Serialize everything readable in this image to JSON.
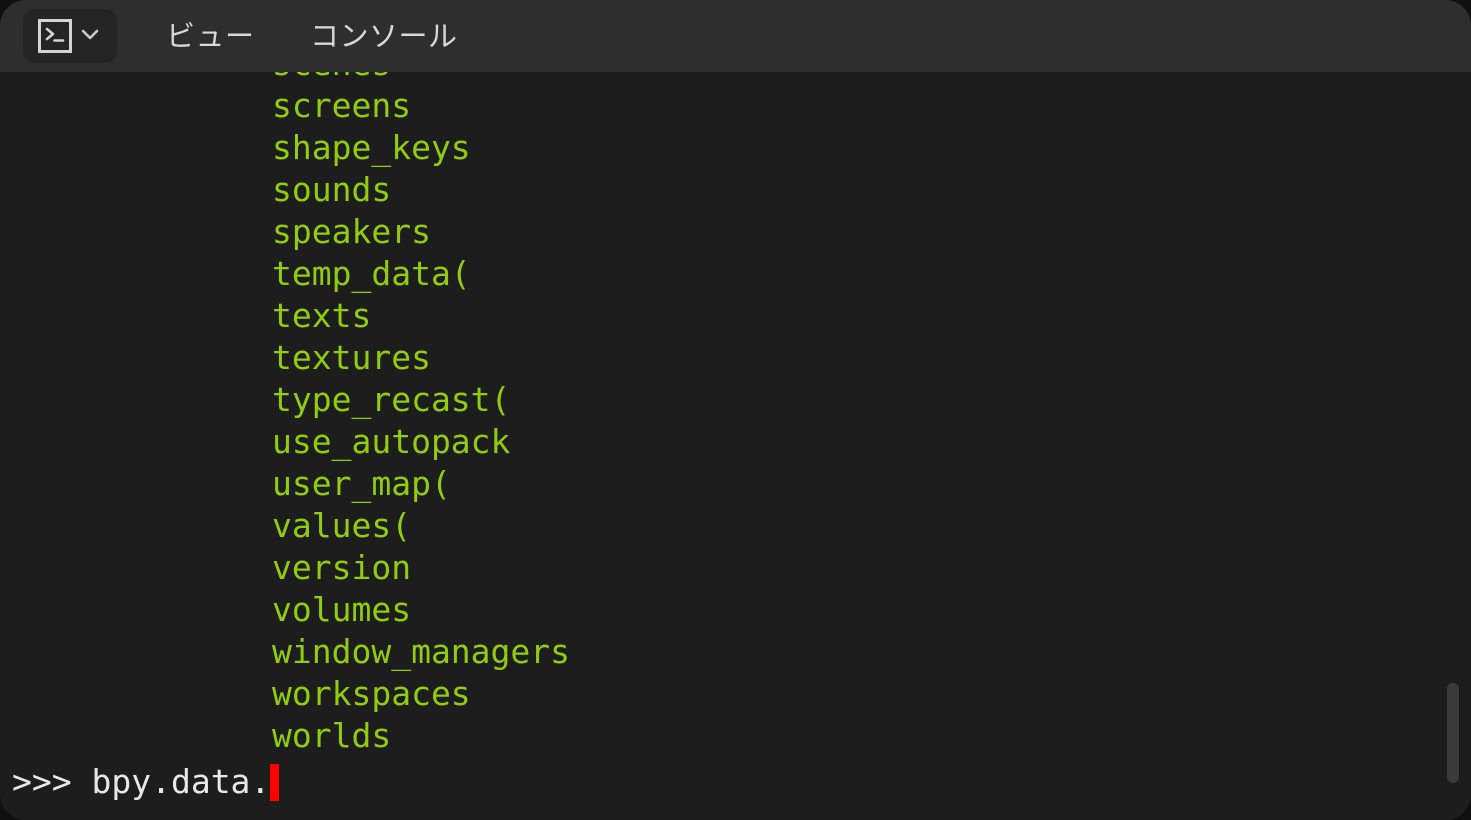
{
  "window": {
    "background": "#1d1d1d",
    "outer_background": "#101010"
  },
  "header": {
    "background": "#2e2e2e",
    "editor_type": {
      "icon": "console-icon",
      "dropdown_icon": "chevron-down-icon"
    },
    "menus": [
      {
        "label": "ビュー",
        "name": "menu-view"
      },
      {
        "label": "コンソール",
        "name": "menu-console"
      }
    ]
  },
  "console": {
    "text_color": "#90cc10",
    "prompt_color": "#e8e8e8",
    "cursor_color": "#ff0000",
    "completion_lines": [
      "scenes",
      "screens",
      "shape_keys",
      "sounds",
      "speakers",
      "temp_data(",
      "texts",
      "textures",
      "type_recast(",
      "use_autopack",
      "user_map(",
      "values(",
      "version",
      "volumes",
      "window_managers",
      "workspaces",
      "worlds"
    ],
    "prompt": {
      "symbol": ">>> ",
      "text": "bpy.data.",
      "cursor": ""
    }
  },
  "scrollbar": {
    "thumb_color": "#3a3a3a"
  }
}
